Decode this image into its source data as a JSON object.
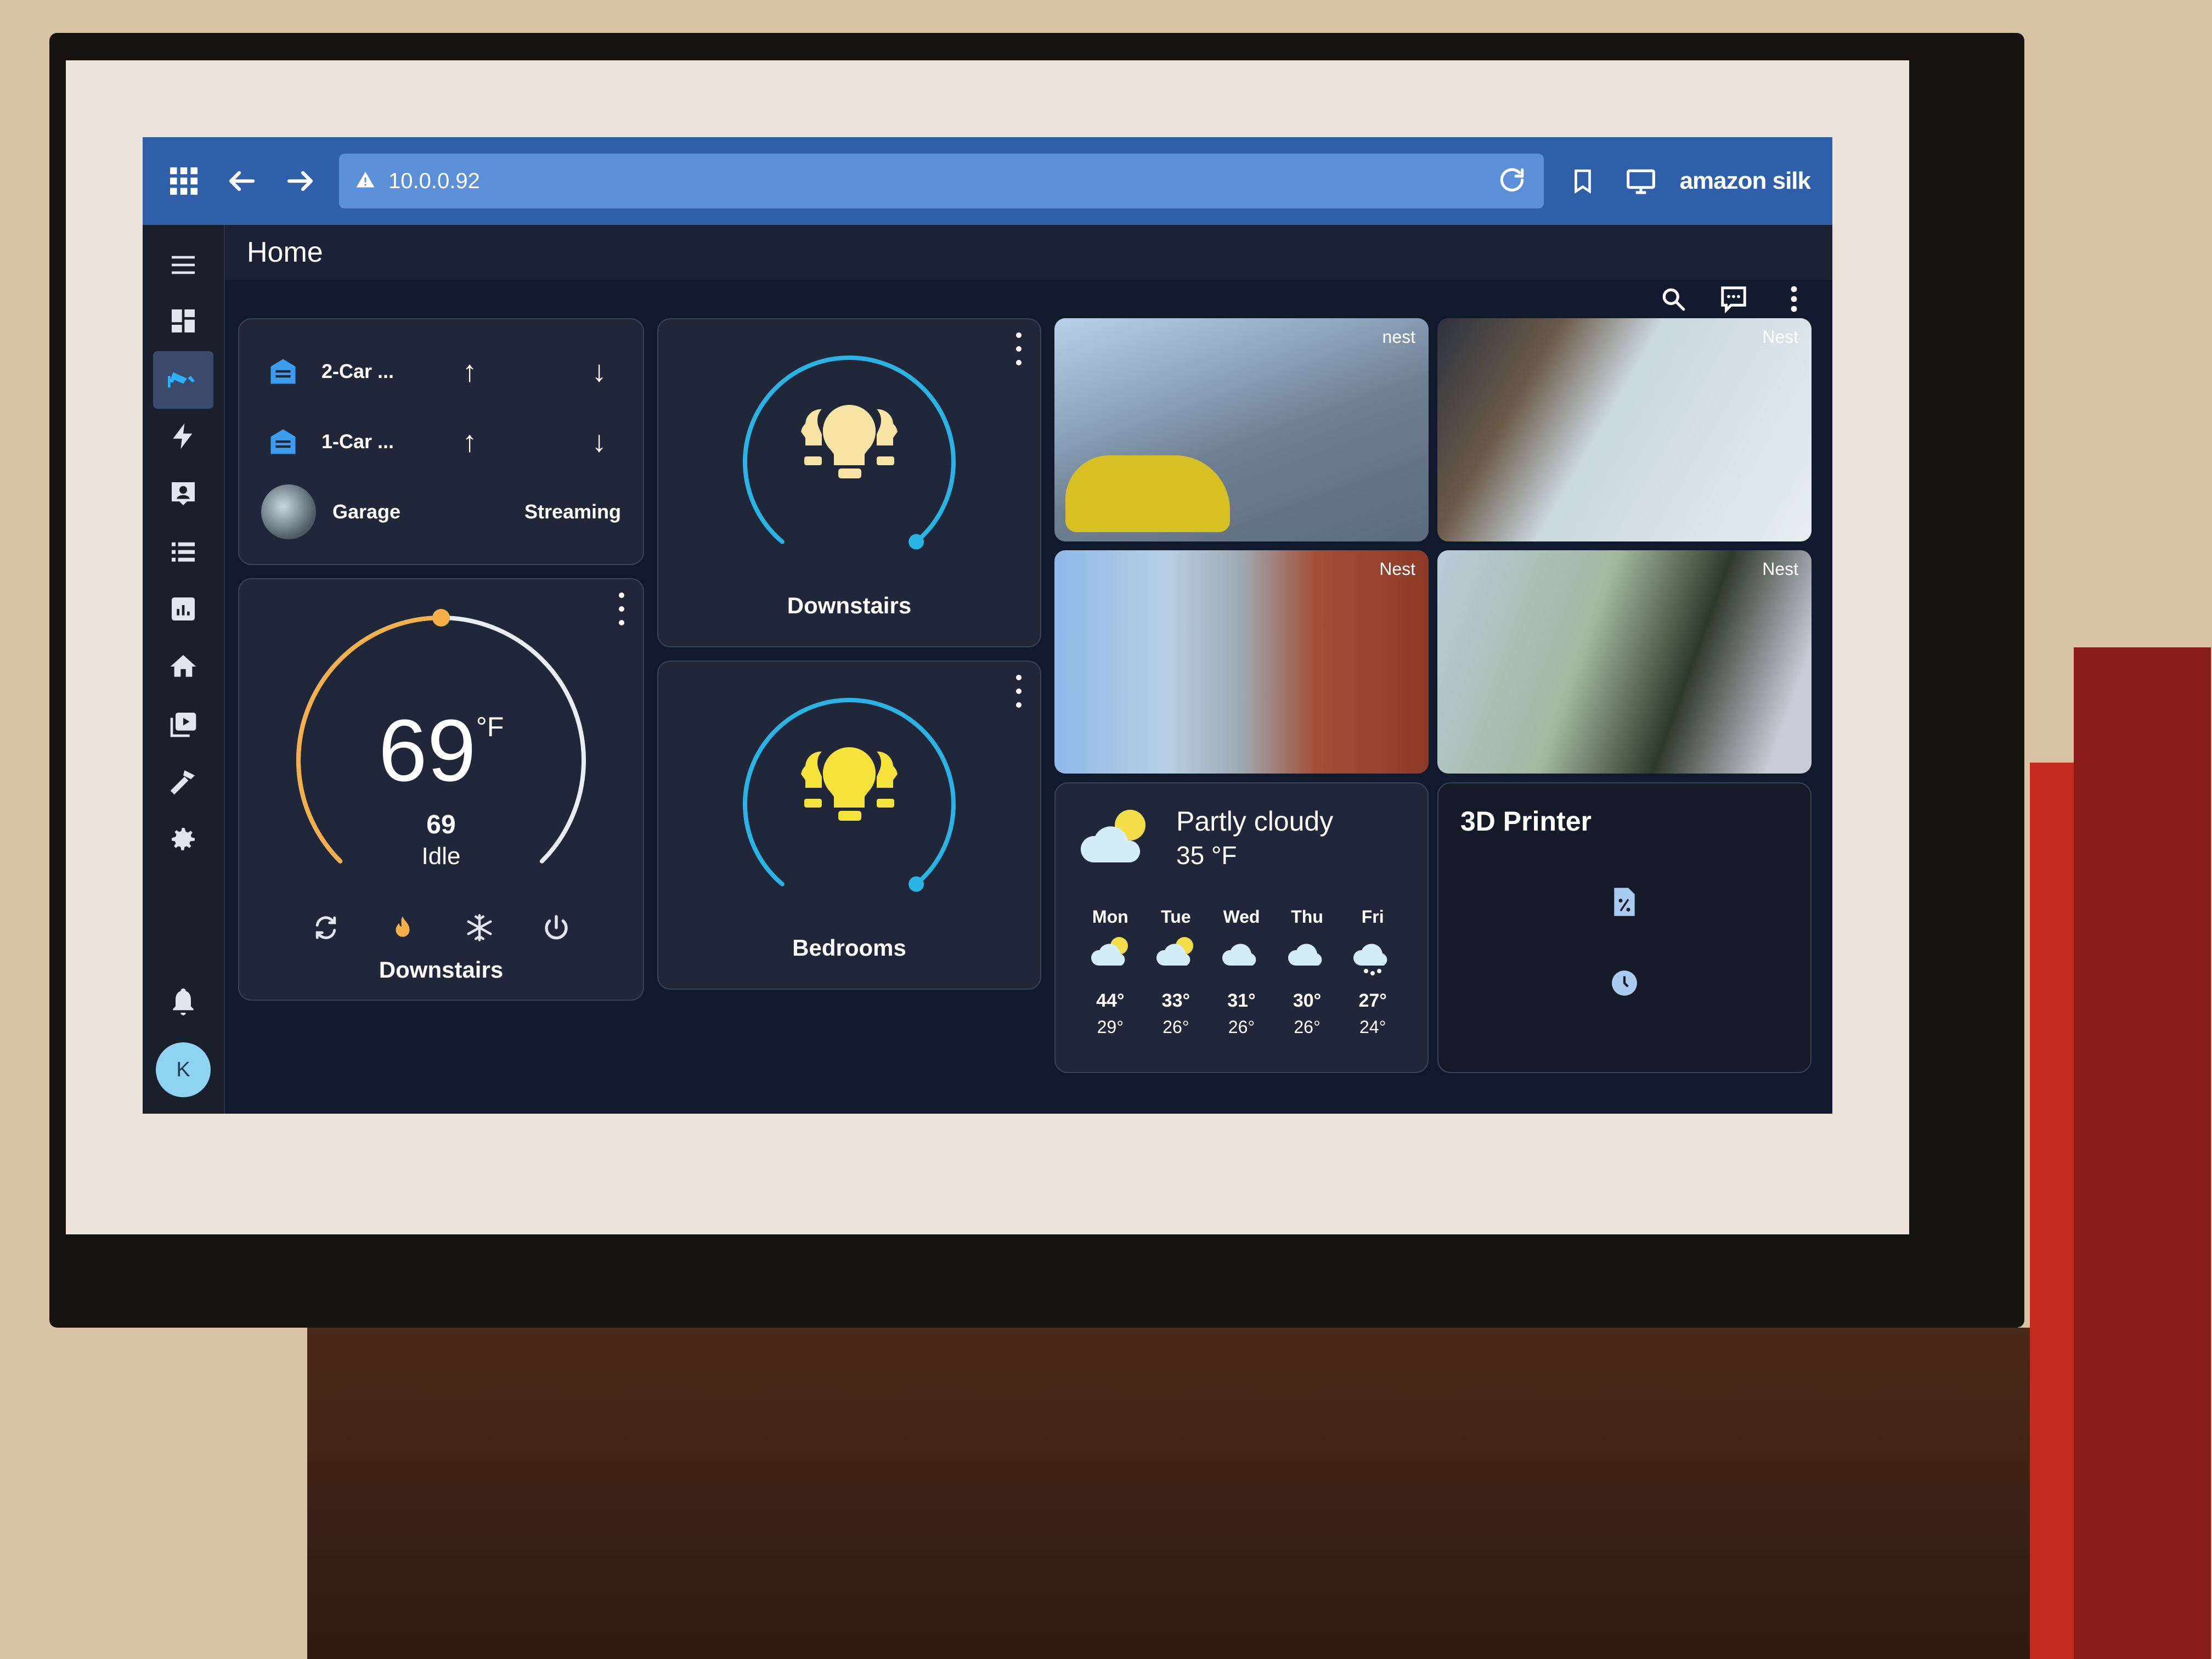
{
  "browser": {
    "url": "10.0.0.92",
    "brand": "amazon silk",
    "icons": [
      "apps-grid-icon",
      "back-arrow-icon",
      "forward-arrow-icon",
      "warning-icon",
      "reload-icon",
      "bookmark-icon",
      "desktop-mode-icon"
    ]
  },
  "header": {
    "title": "Home",
    "actions": [
      "search-icon",
      "assist-icon",
      "more-menu-icon"
    ]
  },
  "sidebar": {
    "items": [
      {
        "name": "overview",
        "icon": "dashboard-icon",
        "active": false
      },
      {
        "name": "cameras",
        "icon": "cctv-icon",
        "active": true
      },
      {
        "name": "energy",
        "icon": "lightning-icon",
        "active": false
      },
      {
        "name": "map",
        "icon": "account-box-icon",
        "active": false
      },
      {
        "name": "logbook",
        "icon": "list-icon",
        "active": false
      },
      {
        "name": "history",
        "icon": "chart-box-icon",
        "active": false
      },
      {
        "name": "home",
        "icon": "home-icon",
        "active": false
      },
      {
        "name": "media",
        "icon": "play-box-icon",
        "active": false
      },
      {
        "name": "developer-tools",
        "icon": "hammer-icon",
        "active": false
      },
      {
        "name": "settings",
        "icon": "cog-icon",
        "active": false
      }
    ],
    "notifications_icon": "bell-icon",
    "user_initial": "K"
  },
  "garage": {
    "rows": [
      {
        "name": "2-Car ...",
        "icon": "garage-icon"
      },
      {
        "name": "1-Car ...",
        "icon": "garage-icon"
      }
    ],
    "camera": {
      "name": "Garage",
      "state": "Streaming"
    }
  },
  "thermostat": {
    "current": "69",
    "unit": "°F",
    "target": "69",
    "action": "Idle",
    "name": "Downstairs",
    "range": [
      40,
      90
    ],
    "setpoint_fraction": 0.5,
    "modes": [
      "heat-cool-icon",
      "heat-icon",
      "cool-icon",
      "off-icon"
    ],
    "active_mode": "heat",
    "colors": {
      "heat": "#f5b04a",
      "track": "#e8eef2"
    }
  },
  "lights": [
    {
      "name": "Downstairs",
      "brightness_fraction": 1.0,
      "color": "#f7e3a3"
    },
    {
      "name": "Bedrooms",
      "brightness_fraction": 1.0,
      "color": "#f5e23a"
    }
  ],
  "light_arc_color": "#2ab4e6",
  "cameras": [
    {
      "label": "nest"
    },
    {
      "label": "Nest"
    },
    {
      "label": "Nest"
    },
    {
      "label": "Nest"
    }
  ],
  "weather": {
    "condition": "Partly cloudy",
    "temperature": "35 °F",
    "forecast": [
      {
        "day": "Mon",
        "icon": "partly-cloudy-icon",
        "high": "44°",
        "low": "29°"
      },
      {
        "day": "Tue",
        "icon": "partly-cloudy-icon",
        "high": "33°",
        "low": "26°"
      },
      {
        "day": "Wed",
        "icon": "cloudy-icon",
        "high": "31°",
        "low": "26°"
      },
      {
        "day": "Thu",
        "icon": "cloudy-icon",
        "high": "30°",
        "low": "26°"
      },
      {
        "day": "Fri",
        "icon": "snowy-icon",
        "high": "27°",
        "low": "24°"
      }
    ]
  },
  "printer": {
    "title": "3D Printer",
    "icons": [
      "file-percent-icon",
      "clock-icon"
    ]
  }
}
